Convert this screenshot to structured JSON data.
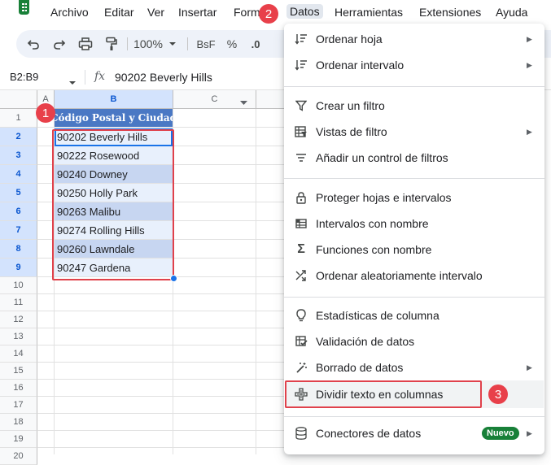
{
  "menubar": {
    "items": [
      "Archivo",
      "Editar",
      "Ver",
      "Insertar",
      "Form",
      "Datos",
      "Herramientas",
      "Extensiones",
      "Ayuda"
    ],
    "active": "Datos"
  },
  "toolbar": {
    "zoom": "100%",
    "format_bsf": "BsF",
    "format_percent": "%",
    "format_decimal": ".0"
  },
  "formula_bar": {
    "name_box": "B2:B9",
    "fx": "fx",
    "value": "90202 Beverly Hills"
  },
  "grid": {
    "columns": [
      "A",
      "B",
      "C"
    ],
    "rows": [
      "1",
      "2",
      "3",
      "4",
      "5",
      "6",
      "7",
      "8",
      "9",
      "10",
      "11",
      "12",
      "13",
      "14",
      "15",
      "16",
      "17",
      "18",
      "19",
      "20"
    ],
    "header": "Código Postal y Ciudad",
    "cells": [
      "90202 Beverly Hills",
      "90222 Rosewood",
      "90240 Downey",
      "90250 Holly Park",
      "90263 Malibu",
      "90274 Rolling Hills",
      "90260 Lawndale",
      "90247 Gardena"
    ]
  },
  "callouts": [
    "1",
    "2",
    "3"
  ],
  "data_menu": {
    "items": [
      {
        "label": "Ordenar hoja",
        "icon": "sort-icon",
        "submenu": true
      },
      {
        "label": "Ordenar intervalo",
        "icon": "sort-icon",
        "submenu": true
      },
      {
        "label": "Crear un filtro",
        "icon": "filter-icon",
        "submenu": false
      },
      {
        "label": "Vistas de filtro",
        "icon": "filter-views-icon",
        "submenu": true
      },
      {
        "label": "Añadir un control de filtros",
        "icon": "slicer-icon",
        "submenu": false
      },
      {
        "label": "Proteger hojas e intervalos",
        "icon": "lock-icon",
        "submenu": false
      },
      {
        "label": "Intervalos con nombre",
        "icon": "named-ranges-icon",
        "submenu": false
      },
      {
        "label": "Funciones con nombre",
        "icon": "sigma-icon",
        "submenu": false
      },
      {
        "label": "Ordenar aleatoriamente intervalo",
        "icon": "shuffle-icon",
        "submenu": false
      },
      {
        "label": "Estadísticas de columna",
        "icon": "lightbulb-icon",
        "submenu": false
      },
      {
        "label": "Validación de datos",
        "icon": "validation-icon",
        "submenu": false
      },
      {
        "label": "Borrado de datos",
        "icon": "magic-wand-icon",
        "submenu": true
      },
      {
        "label": "Dividir texto en columnas",
        "icon": "split-icon",
        "submenu": false
      },
      {
        "label": "Conectores de datos",
        "icon": "database-icon",
        "submenu": true,
        "badge": "Nuevo"
      }
    ]
  },
  "colors": {
    "accent_blue": "#1a73e8",
    "header_blue": "#4a78c4",
    "callout_red": "#e8404a",
    "new_green": "#188038"
  }
}
